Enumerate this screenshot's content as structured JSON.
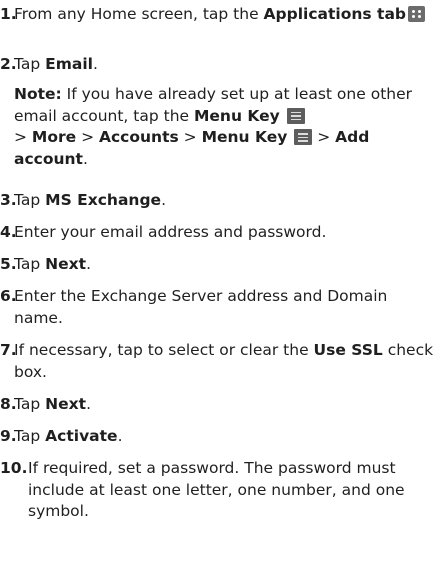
{
  "steps": [
    {
      "num": "1.",
      "pre": "From any Home screen, tap the ",
      "bold": "Applications tab",
      "icon": "apps-grid-icon"
    },
    {
      "num": "2.",
      "pre": "Tap ",
      "bold": "Email",
      "post": "."
    },
    {
      "note": {
        "label": "Note:",
        "t1": " If you have already set up at least one other email account, tap the ",
        "b1": "Menu Key",
        "icon1": "menu-key-icon",
        "t2": " > ",
        "b2": "More",
        "t3": " > ",
        "b3": "Accounts",
        "t4": " > ",
        "b4": "Menu Key",
        "icon2": "menu-key-icon",
        "t5": " > ",
        "b5": "Add account",
        "t6": "."
      }
    },
    {
      "num": "3.",
      "pre": "Tap ",
      "bold": "MS Exchange",
      "post": "."
    },
    {
      "num": "4.",
      "pre": "Enter your email address and password."
    },
    {
      "num": "5.",
      "pre": "Tap ",
      "bold": "Next",
      "post": "."
    },
    {
      "num": "6.",
      "pre": "Enter the Exchange Server address and Domain name."
    },
    {
      "num": "7.",
      "pre": "If necessary, tap to select or clear the ",
      "bold": "Use SSL",
      "post": " check box."
    },
    {
      "num": "8.",
      "pre": "Tap ",
      "bold": "Next",
      "post": "."
    },
    {
      "num": "9.",
      "pre": "Tap ",
      "bold": "Activate",
      "post": "."
    },
    {
      "num": "10.",
      "pre": "If required, set a password. The password must include at least one letter, one number, and one symbol."
    }
  ]
}
